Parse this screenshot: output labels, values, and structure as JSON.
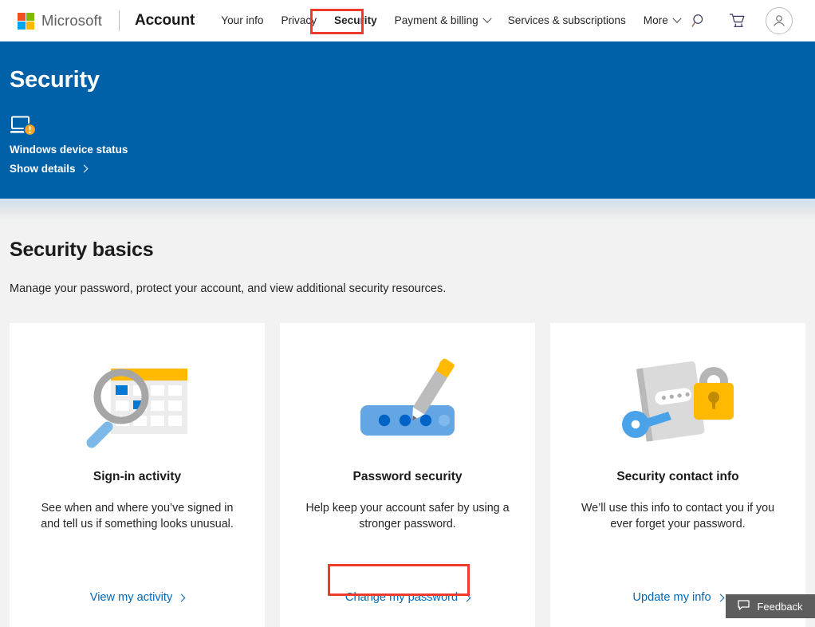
{
  "topnav": {
    "brand": "Microsoft",
    "app_name": "Account",
    "items": [
      {
        "label": "Your info",
        "has_caret": false,
        "active": false
      },
      {
        "label": "Privacy",
        "has_caret": false,
        "active": false
      },
      {
        "label": "Security",
        "has_caret": false,
        "active": true
      },
      {
        "label": "Payment & billing",
        "has_caret": true,
        "active": false
      },
      {
        "label": "Services & subscriptions",
        "has_caret": false,
        "active": false
      },
      {
        "label": "More",
        "has_caret": true,
        "active": false
      }
    ],
    "icons": {
      "search": "search-icon",
      "cart": "cart-icon",
      "account": "account-avatar-icon"
    }
  },
  "hero": {
    "title": "Security",
    "device_status_label": "Windows device status",
    "device_status_icon": "laptop-warning-icon",
    "show_details_label": "Show details",
    "background_color": "#0060a8"
  },
  "main": {
    "section_title": "Security basics",
    "section_subtitle": "Manage your password, protect your account, and view additional security resources.",
    "cards": [
      {
        "icon": "calendar-magnifier-icon",
        "title": "Sign-in activity",
        "description": "See when and where you’ve signed in and tell us if something looks unusual.",
        "link_label": "View my activity"
      },
      {
        "icon": "password-pen-icon",
        "title": "Password security",
        "description": "Help keep your account safer by using a stronger password.",
        "link_label": "Change my password"
      },
      {
        "icon": "key-lock-document-icon",
        "title": "Security contact info",
        "description": "We’ll use this info to contact you if you ever forget your password.",
        "link_label": "Update my info"
      }
    ]
  },
  "feedback": {
    "label": "Feedback",
    "icon": "speech-bubble-icon"
  },
  "annotations": {
    "color": "#ef3b2d",
    "highlighted": [
      "Security",
      "Change my password"
    ]
  },
  "colors": {
    "link": "#0067b8",
    "hero_blue": "#0060a8",
    "page_background": "#f2f2f2",
    "annotation_red": "#ef3b2d"
  }
}
